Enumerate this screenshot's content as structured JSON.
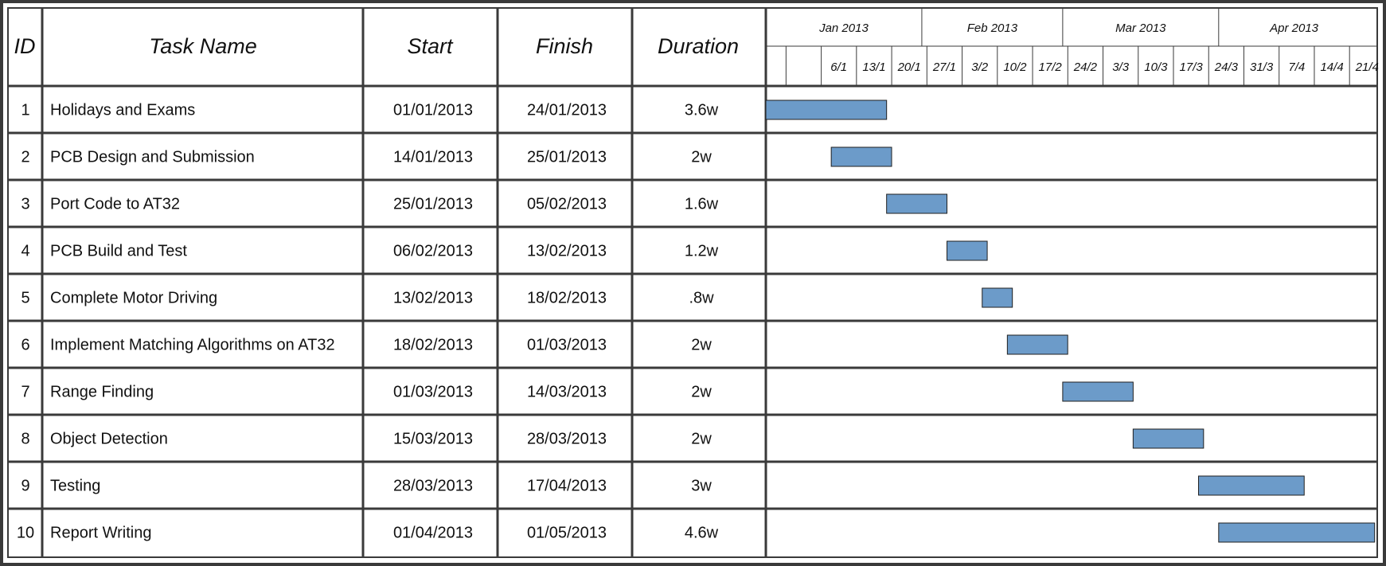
{
  "table": {
    "columns": {
      "id": "ID",
      "task": "Task Name",
      "start": "Start",
      "finish": "Finish",
      "duration": "Duration"
    },
    "rows": [
      {
        "id": "1",
        "task": "Holidays and Exams",
        "start": "01/01/2013",
        "finish": "24/01/2013",
        "duration": "3.6w"
      },
      {
        "id": "2",
        "task": "PCB Design and Submission",
        "start": "14/01/2013",
        "finish": "25/01/2013",
        "duration": "2w"
      },
      {
        "id": "3",
        "task": "Port Code to AT32",
        "start": "25/01/2013",
        "finish": "05/02/2013",
        "duration": "1.6w"
      },
      {
        "id": "4",
        "task": "PCB Build and Test",
        "start": "06/02/2013",
        "finish": "13/02/2013",
        "duration": "1.2w"
      },
      {
        "id": "5",
        "task": "Complete Motor Driving",
        "start": "13/02/2013",
        "finish": "18/02/2013",
        "duration": ".8w"
      },
      {
        "id": "6",
        "task": "Implement Matching Algorithms on AT32",
        "start": "18/02/2013",
        "finish": "01/03/2013",
        "duration": "2w"
      },
      {
        "id": "7",
        "task": "Range Finding",
        "start": "01/03/2013",
        "finish": "14/03/2013",
        "duration": "2w"
      },
      {
        "id": "8",
        "task": "Object Detection",
        "start": "15/03/2013",
        "finish": "28/03/2013",
        "duration": "2w"
      },
      {
        "id": "9",
        "task": "Testing",
        "start": "28/03/2013",
        "finish": "17/04/2013",
        "duration": "3w"
      },
      {
        "id": "10",
        "task": "Report Writing",
        "start": "01/04/2013",
        "finish": "01/05/2013",
        "duration": "4.6w"
      }
    ]
  },
  "timeline": {
    "months": [
      "Jan 2013",
      "Feb 2013",
      "Mar 2013",
      "Apr 2013"
    ],
    "weeks": [
      "6/1",
      "13/1",
      "20/1",
      "27/1",
      "3/2",
      "10/2",
      "17/2",
      "24/2",
      "3/3",
      "10/3",
      "17/3",
      "24/3",
      "31/3",
      "7/4",
      "14/4",
      "21/4"
    ]
  },
  "colors": {
    "bar_fill": "#6c9bc9",
    "bar_stroke": "#1f1f1f",
    "grid": "#3a3a3a",
    "frame": "#3a3a3a"
  },
  "chart_data": {
    "type": "gantt",
    "categories": [
      "Holidays and Exams",
      "PCB Design and Submission",
      "Port Code to AT32",
      "PCB Build and Test",
      "Complete Motor Driving",
      "Implement Matching Algorithms on AT32",
      "Range Finding",
      "Object Detection",
      "Testing",
      "Report Writing"
    ],
    "bars": [
      {
        "start": "2013-01-01",
        "end": "2013-01-25"
      },
      {
        "start": "2013-01-14",
        "end": "2013-01-26"
      },
      {
        "start": "2013-01-25",
        "end": "2013-02-06"
      },
      {
        "start": "2013-02-06",
        "end": "2013-02-14"
      },
      {
        "start": "2013-02-13",
        "end": "2013-02-19"
      },
      {
        "start": "2013-02-18",
        "end": "2013-03-02"
      },
      {
        "start": "2013-03-01",
        "end": "2013-03-15"
      },
      {
        "start": "2013-03-15",
        "end": "2013-03-29"
      },
      {
        "start": "2013-03-28",
        "end": "2013-04-18"
      },
      {
        "start": "2013-04-01",
        "end": "2013-05-02"
      }
    ],
    "x_range": [
      "2013-01-01",
      "2013-04-30"
    ]
  }
}
